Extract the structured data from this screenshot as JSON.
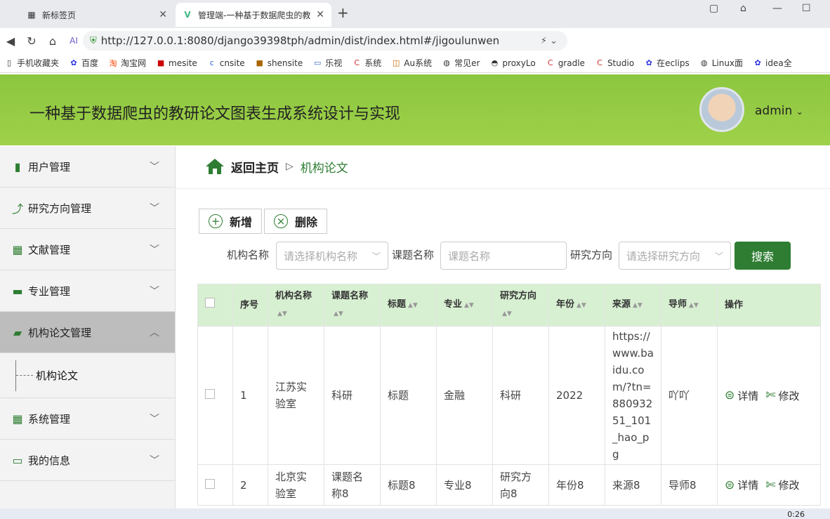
{
  "browser": {
    "tabs": [
      {
        "title": "新标签页",
        "active": false
      },
      {
        "title": "管理端-一种基于数据爬虫的教",
        "active": true
      }
    ],
    "url": "http://127.0.0.1:8080/django39398tph/admin/dist/index.html#/jigoulunwen",
    "bookmarks": [
      "手机收藏夹",
      "百度",
      "淘宝网",
      "mesite",
      "cnsite",
      "shensite",
      "乐视",
      "系统",
      "Au系统",
      "常见er",
      "proxyLo",
      "gradle",
      "Studio",
      "在eclips",
      "Linux面",
      "idea全"
    ]
  },
  "header": {
    "title": "一种基于数据爬虫的教研论文图表生成系统设计与实现",
    "user": "admin",
    "accent": "#8cc63f"
  },
  "sidebar": {
    "items": [
      {
        "label": "用户管理",
        "icon": "bar-chart-icon"
      },
      {
        "label": "研究方向管理",
        "icon": "line-chart-icon"
      },
      {
        "label": "文献管理",
        "icon": "grid-icon"
      },
      {
        "label": "专业管理",
        "icon": "monitor-icon"
      },
      {
        "label": "机构论文管理",
        "icon": "briefcase-icon",
        "active": true,
        "children": [
          "机构论文"
        ]
      },
      {
        "label": "系统管理",
        "icon": "grid-icon"
      },
      {
        "label": "我的信息",
        "icon": "card-icon"
      }
    ]
  },
  "breadcrumb": {
    "home": "返回主页",
    "current": "机构论文"
  },
  "toolbar": {
    "add": "新增",
    "delete": "删除"
  },
  "filters": {
    "org_label": "机构名称",
    "org_placeholder": "请选择机构名称",
    "topic_label": "课题名称",
    "topic_placeholder": "课题名称",
    "dir_label": "研究方向",
    "dir_placeholder": "请选择研究方向",
    "search": "搜索"
  },
  "table": {
    "headers": {
      "index": "序号",
      "org": "机构名称",
      "topic": "课题名称",
      "title": "标题",
      "major": "专业",
      "direction": "研究方向",
      "year": "年份",
      "source": "来源",
      "advisor": "导师",
      "ops": "操作"
    },
    "rows": [
      {
        "index": "1",
        "org": "江苏实验室",
        "topic": "科研",
        "title": "标题",
        "major": "金融",
        "direction": "科研",
        "year": "2022",
        "source": "https://www.baidu.com/?tn=88093251_101_hao_pg",
        "advisor": "吖吖"
      },
      {
        "index": "2",
        "org": "北京实验室",
        "topic": "课题名称8",
        "title": "标题8",
        "major": "专业8",
        "direction": "研究方向8",
        "year": "年份8",
        "source": "来源8",
        "advisor": "导师8"
      }
    ],
    "ops": {
      "detail": "详情",
      "edit": "修改"
    }
  },
  "taskbar": {
    "time": "0:26"
  }
}
